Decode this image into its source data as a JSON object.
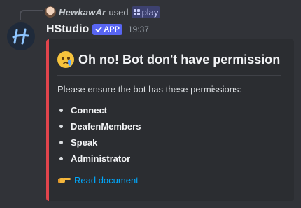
{
  "command": {
    "user": "HewkawAr",
    "used_text": "used",
    "command_name": "play"
  },
  "message": {
    "bot_name": "HStudio",
    "badge": "APP",
    "timestamp": "19:37"
  },
  "embed": {
    "accent_color": "#e1444c",
    "title": "Oh no! Bot don't have permission",
    "title_icon": "crying-face-icon",
    "description": "Please ensure the bot has these permissions:",
    "permissions": [
      "Connect",
      "DeafenMembers",
      "Speak",
      "Administrator"
    ],
    "link_icon": "pointing-right-icon",
    "link_text": "Read document"
  },
  "colors": {
    "background": "#313338",
    "embed_bg": "#2b2d31",
    "link": "#00a8fc",
    "badge": "#5865f2"
  }
}
